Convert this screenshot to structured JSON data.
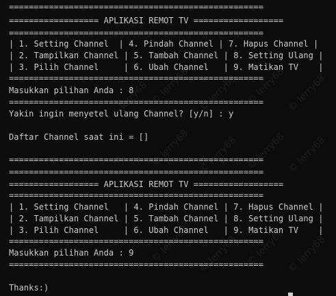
{
  "terminal": {
    "lines": [
      "===================================================",
      "================== APLIKASI REMOT TV ==================",
      "===================================================",
      "| 1. Setting Channel  | 4. Pindah Channel | 7. Hapus Channel |",
      "| 2. Tampilkan Channel | 5. Tambah Channel | 8. Setting Ulang |",
      "| 3. Pilih Channel     | 6. Ubah Channel   | 9. Matikan TV    |",
      "===================================================",
      "Masukkan pilihan Anda : 8",
      "===================================================",
      "Yakin ingin menyetel ulang Channel? [y/n] : y",
      "",
      "Daftar Channel saat ini = []",
      "",
      "===================================================",
      "",
      "===================================================",
      "================== APLIKASI REMOT TV ==================",
      "===================================================",
      "| 1. Setting Channel   | 4. Pindah Channel | 7. Hapus Channel |",
      "| 2. Tampilkan Channel | 5. Tambah Channel | 8. Setting Ulang |",
      "| 3. Pilih Channel     | 6. Ubah Channel   | 9. Matikan TV    |",
      "===================================================",
      "Masukkan pilihan Anda : 9",
      "===================================================",
      "",
      "Thanks:)"
    ]
  },
  "watermark": {
    "text": "© lerry68"
  },
  "colors": {
    "background": "#0c0c0c",
    "text": "#cccccc"
  }
}
